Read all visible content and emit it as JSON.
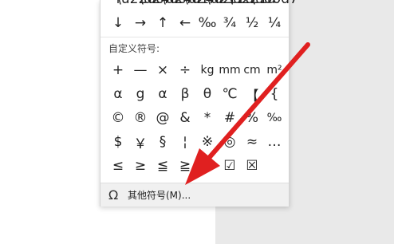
{
  "top_row": [
    "↓",
    "→",
    "↑",
    "←",
    "‰",
    "¾",
    "½",
    "¼"
  ],
  "custom_section": {
    "label": "自定义符号:",
    "rows": [
      [
        "+",
        "—",
        "×",
        "÷",
        "kg",
        "mm",
        "cm",
        "m²"
      ],
      [
        "α",
        "g",
        "α",
        "β",
        "θ",
        "℃",
        "【",
        "{"
      ],
      [
        "©",
        "®",
        "@",
        "&",
        "*",
        "#",
        "%",
        "‰"
      ],
      [
        "$",
        "￥",
        "§",
        "¦",
        "※",
        "◎",
        "≈",
        "…"
      ],
      [
        "≤",
        "≥",
        "≦",
        "≧",
        "☐",
        "☑",
        "☒",
        ""
      ]
    ]
  },
  "footer": {
    "icon": "Ω",
    "label": "其他符号(M)..."
  },
  "colors": {
    "arrow": "#e02020",
    "panel_bg": "#ffffff",
    "footer_bg": "#f0f0f0"
  }
}
